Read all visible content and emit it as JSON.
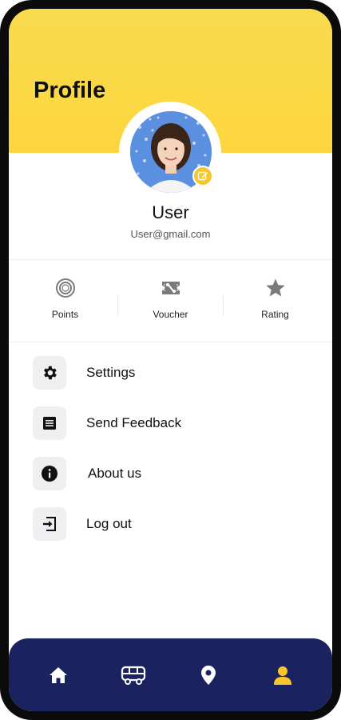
{
  "header": {
    "title": "Profile"
  },
  "profile": {
    "name": "User",
    "email": "User@gmail.com"
  },
  "stats": [
    {
      "label": "Points",
      "icon": "coin-icon"
    },
    {
      "label": "Voucher",
      "icon": "voucher-icon"
    },
    {
      "label": "Rating",
      "icon": "star-icon"
    }
  ],
  "menu": [
    {
      "label": "Settings",
      "icon": "gear-icon"
    },
    {
      "label": "Send Feedback",
      "icon": "feedback-icon"
    },
    {
      "label": "About us",
      "icon": "info-icon"
    },
    {
      "label": "Log out",
      "icon": "logout-icon"
    }
  ],
  "nav": [
    {
      "icon": "home-icon",
      "active": false
    },
    {
      "icon": "bus-icon",
      "active": false
    },
    {
      "icon": "location-pin-icon",
      "active": false
    },
    {
      "icon": "user-icon",
      "active": true
    }
  ],
  "colors": {
    "header_yellow": "#fdd63e",
    "nav_navy": "#1a2360",
    "active_yellow": "#f6c62c",
    "icon_gray": "#7a7a7a"
  }
}
